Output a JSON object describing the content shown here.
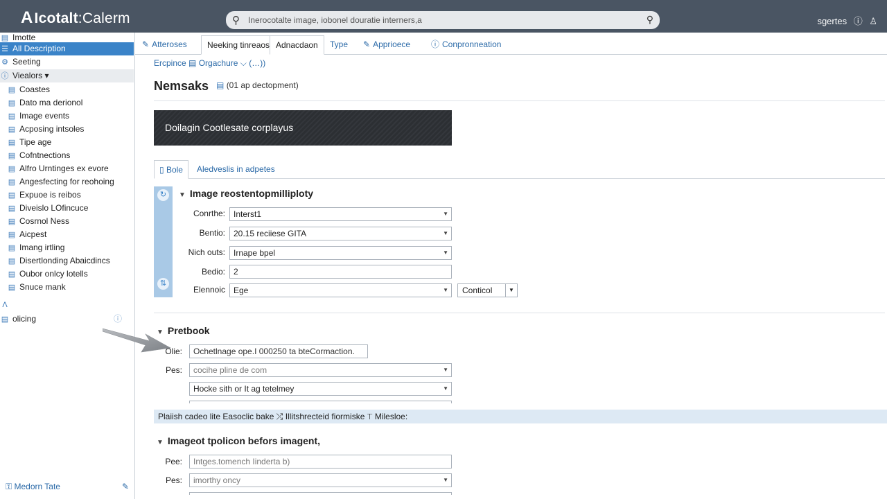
{
  "app": {
    "logo_mark": "A",
    "logo_bold": "Icotalt",
    "logo_rest": ":Calerm"
  },
  "search": {
    "placeholder": "Inerocotalte image, iobonel douratie interners,a"
  },
  "user": {
    "name": "sgertes",
    "icons": [
      "help-icon",
      "user-icon"
    ]
  },
  "sidebar": {
    "items": [
      {
        "label": "Imotte",
        "icon": "folder-icon"
      },
      {
        "label": "All Description",
        "icon": "list-icon",
        "active": true
      },
      {
        "label": "Seeting",
        "icon": "gear-icon"
      },
      {
        "label": "Viealors",
        "icon": "info-icon",
        "group": true,
        "caret": "▾"
      },
      {
        "label": "Coastes",
        "icon": "doc-icon"
      },
      {
        "label": "Dato ma derionol",
        "icon": "doc-icon"
      },
      {
        "label": "Image events",
        "icon": "doc-icon"
      },
      {
        "label": "Acposing intsoles",
        "icon": "doc-icon"
      },
      {
        "label": "Tipe age",
        "icon": "doc-icon"
      },
      {
        "label": "Cofntnections",
        "icon": "doc-icon"
      },
      {
        "label": "Alfro Urntinges ex evore",
        "icon": "doc-icon"
      },
      {
        "label": "Angesfecting for reohoing",
        "icon": "doc-icon"
      },
      {
        "label": "Expuoe is reibos",
        "icon": "doc-icon"
      },
      {
        "label": "Diveislo LOfincuce",
        "icon": "doc-icon"
      },
      {
        "label": "Cosrnol Ness",
        "icon": "doc-icon"
      },
      {
        "label": "Aicpest",
        "icon": "doc-icon"
      },
      {
        "label": "Imang irtling",
        "icon": "doc-icon"
      },
      {
        "label": "Disertlonding Abaicdincs",
        "icon": "doc-icon"
      },
      {
        "label": "Oubor onlcy lotells",
        "icon": "doc-icon"
      },
      {
        "label": "Snuce mank",
        "icon": "doc-icon"
      }
    ],
    "extra_item": {
      "label": "olicing",
      "icon": "list-icon"
    },
    "footer": {
      "label": "Medorn Tate"
    }
  },
  "tabs": [
    {
      "label": "Atteroses",
      "icon": "edit-icon"
    },
    {
      "label": "Neeking tinreaos",
      "selected": true
    },
    {
      "label": "Adnacdaon"
    },
    {
      "label": "Type"
    },
    {
      "label": "Apprioece",
      "icon": "edit-icon"
    },
    {
      "label": "Conpronneation",
      "icon": "info-icon"
    }
  ],
  "breadcrumb": {
    "part1": "Ercpince",
    "part2": "Orgachure",
    "caret": "⌵",
    "part3": "(…))"
  },
  "page": {
    "title": "Nemsaks",
    "subtitle": "(01 ap dectopment)"
  },
  "banner": {
    "text": "Doilagin Cootlesate corplayus"
  },
  "subtabs": [
    {
      "label": "Bole",
      "selected": true
    },
    {
      "label": "Aledveslis in adpetes"
    }
  ],
  "section1": {
    "title": "Image reostentopmilliploty",
    "rows": [
      {
        "label": "Conrthe:",
        "value": "Interst1",
        "dropdown": true
      },
      {
        "label": "Bentio:",
        "value": "20.15 reciiese GITA",
        "dropdown": true
      },
      {
        "label": "Nich outs:",
        "value": "Irnape bpel",
        "dropdown": true
      },
      {
        "label": "Bedio:",
        "value": "2",
        "dropdown": false
      },
      {
        "label": "Elennoic",
        "value": "Ege",
        "dropdown": true
      }
    ],
    "extra_select": "Conticol"
  },
  "section2": {
    "title": "Pretbook",
    "rows": [
      {
        "label": "Olie:",
        "value": "Ochetlnage ope.I 000250 ta bteCormaction."
      },
      {
        "label": "Pes:",
        "value": "cocihe pline de com",
        "placeholder": true
      },
      {
        "label": "",
        "value": "Hocke sith or It ag tetelmey"
      }
    ]
  },
  "infobar": {
    "text": "Plaiish cadeo lite Easoclic bake  ⤮  Illitshrecteid fiormiske  ⊤  Milesloe:"
  },
  "section3": {
    "title": "Imageot tpolicon befors imagent,",
    "rows": [
      {
        "label": "Pee:",
        "value": "Intges.tomench Iinderta b)",
        "placeholder": true
      },
      {
        "label": "Pes:",
        "value": "imorthy oncy",
        "placeholder": true
      }
    ]
  }
}
